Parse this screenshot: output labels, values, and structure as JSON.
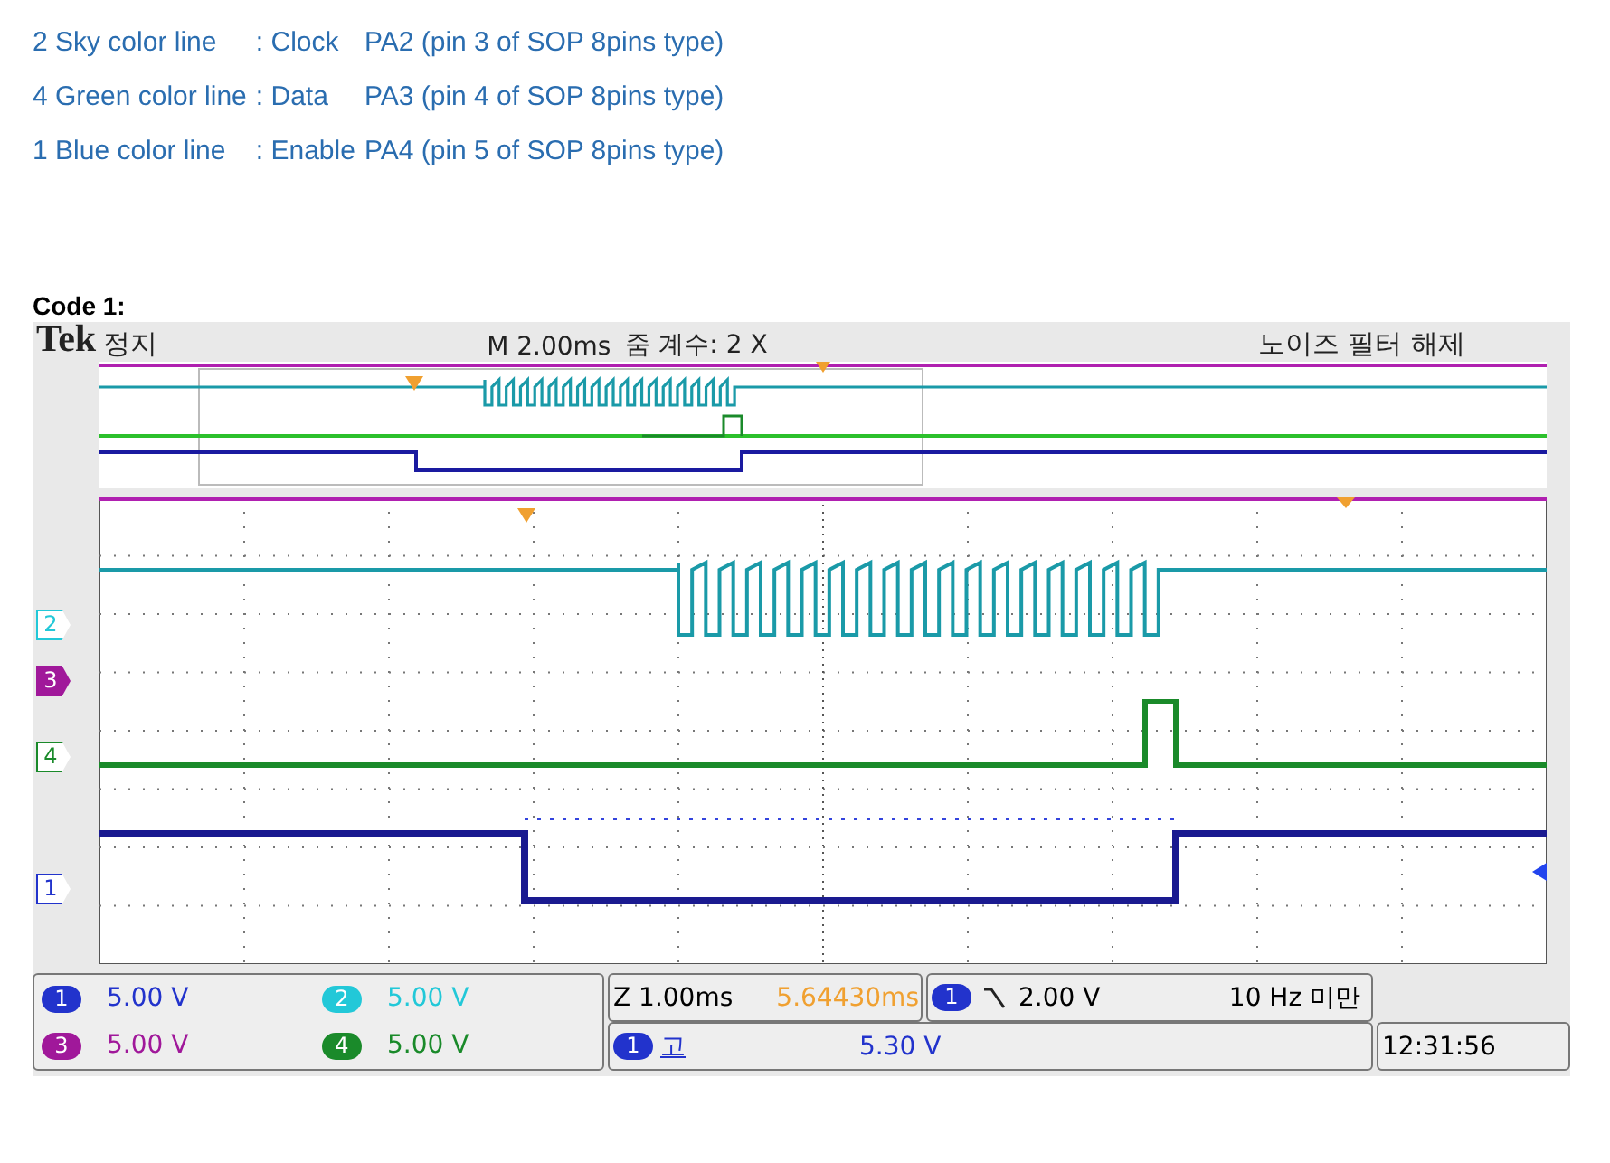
{
  "legend": [
    {
      "label": "2 Sky color line",
      "signal": ": Clock",
      "pin": "PA2 (pin 3 of SOP 8pins type)"
    },
    {
      "label": "4 Green color line",
      "signal": ": Data",
      "pin": "PA3 (pin 4 of SOP 8pins type)"
    },
    {
      "label": "1 Blue color line",
      "signal": ": Enable",
      "pin": "PA4 (pin 5 of SOP 8pins type)"
    }
  ],
  "code_heading": "Code 1:",
  "scope": {
    "brand": "Tek",
    "run_state": "정지",
    "timebase": "M 2.00ms",
    "zoom_factor": "줌 계수: 2 X",
    "noise_filter": "노이즈 필터 해제",
    "channel_markers": [
      {
        "label": "2",
        "color": "#22c8d8",
        "filled": false
      },
      {
        "label": "3",
        "color": "#a0189a",
        "filled": true
      },
      {
        "label": "4",
        "color": "#1a8a2a",
        "filled": false
      },
      {
        "label": "1",
        "color": "#2233cc",
        "filled": false
      }
    ],
    "channels": [
      {
        "badge": "1",
        "scale": "5.00 V",
        "color": "#2233cc"
      },
      {
        "badge": "2",
        "scale": "5.00 V",
        "color": "#22c8d8"
      },
      {
        "badge": "3",
        "scale": "5.00 V",
        "color": "#a0189a"
      },
      {
        "badge": "4",
        "scale": "5.00 V",
        "color": "#1a8a2a"
      }
    ],
    "zoom_time": "Z 1.00ms",
    "zoom_position": "5.64430ms",
    "trigger_badge": "1",
    "trigger_level": "2.00 V",
    "trigger_freq": "10 Hz 미만",
    "ref_badge": "1",
    "ref_label": "고",
    "ref_value": "5.30 V",
    "clock": "12:31:56"
  }
}
